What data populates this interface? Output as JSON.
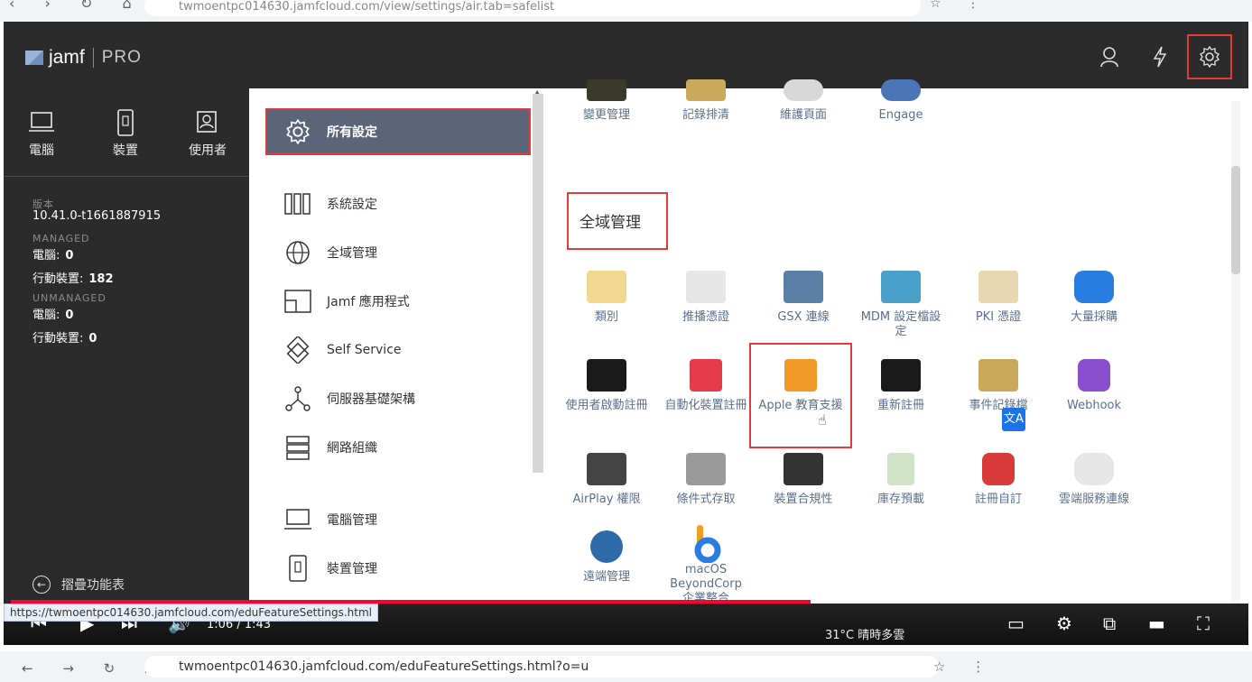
{
  "browser": {
    "top_url": "twmoentpc014630.jamfcloud.com/view/settings/air.tab=safelist",
    "bottom_url": "twmoentpc014630.jamfcloud.com/eduFeatureSettings.html?o=u"
  },
  "header": {
    "logo_text": "jamf",
    "logo_pro": "PRO",
    "icons": [
      "user-icon",
      "lightning-icon",
      "gear-icon"
    ]
  },
  "nav": {
    "items": [
      {
        "label": "電腦",
        "icon": "computer-icon"
      },
      {
        "label": "裝置",
        "icon": "device-icon"
      },
      {
        "label": "使用者",
        "icon": "users-icon"
      }
    ]
  },
  "info": {
    "version_label": "版本",
    "version": "10.41.0-t1661887915",
    "managed_label": "MANAGED",
    "managed_computers_label": "電腦:",
    "managed_computers": "0",
    "managed_devices_label": "行動裝置:",
    "managed_devices": "182",
    "unmanaged_label": "UNMANAGED",
    "unmanaged_computers_label": "電腦:",
    "unmanaged_computers": "0",
    "unmanaged_devices_label": "行動裝置:",
    "unmanaged_devices": "0"
  },
  "collapse_label": "摺疊功能表",
  "categories": [
    {
      "label": "所有設定",
      "icon": "gear-icon",
      "active": true
    },
    {
      "label": "系統設定",
      "icon": "columns-icon"
    },
    {
      "label": "全域管理",
      "icon": "globe-icon"
    },
    {
      "label": "Jamf 應用程式",
      "icon": "app-icon"
    },
    {
      "label": "Self Service",
      "icon": "self-service-icon"
    },
    {
      "label": "伺服器基礎架構",
      "icon": "network-node-icon"
    },
    {
      "label": "網路組織",
      "icon": "server-stack-icon"
    },
    {
      "label": "電腦管理",
      "icon": "computer-icon"
    },
    {
      "label": "裝置管理",
      "icon": "device-icon"
    }
  ],
  "section_title": "全域管理",
  "top_tiles": [
    {
      "label": "變更管理",
      "color": "#3a3a2a"
    },
    {
      "label": "記錄排清",
      "color": "#c9a95a"
    },
    {
      "label": "維護頁面",
      "color": "#d8d8d8"
    },
    {
      "label": "Engage",
      "color": "#4a76b8"
    }
  ],
  "tiles": [
    {
      "label": "類別",
      "color": "#f0d890",
      "icon": "folder-icon"
    },
    {
      "label": "推播憑證",
      "color": "#e6e6e6",
      "icon": "cloud-push-icon"
    },
    {
      "label": "GSX 連線",
      "color": "#5c7fa8",
      "icon": "gsx-icon"
    },
    {
      "label": "MDM 設定檔設定",
      "color": "#4aa0c8",
      "icon": "mdm-profile-icon"
    },
    {
      "label": "PKI 憑證",
      "color": "#e8d7b0",
      "icon": "certificate-icon"
    },
    {
      "label": "大量採購",
      "color": "#2a7de0",
      "icon": "app-store-icon"
    },
    {
      "label": "使用者啟動註冊",
      "color": "#1a1a1a",
      "icon": "user-enrollment-icon"
    },
    {
      "label": "自動化裝置註冊",
      "color": "#e63b4a",
      "icon": "device-enrollment-icon"
    },
    {
      "label": "Apple 教育支援",
      "color": "#f19a2a",
      "icon": "education-icon"
    },
    {
      "label": "重新註冊",
      "color": "#1a1a1a",
      "icon": "re-enrollment-icon"
    },
    {
      "label": "事件記錄檔",
      "color": "#c9a95a",
      "icon": "event-log-icon"
    },
    {
      "label": "Webhook",
      "color": "#8a4fcf",
      "icon": "webhook-icon"
    },
    {
      "label": "AirPlay 權限",
      "color": "#444",
      "icon": "airplay-icon"
    },
    {
      "label": "條件式存取",
      "color": "#9a9a9a",
      "icon": "conditional-access-icon"
    },
    {
      "label": "裝置合規性",
      "color": "#333",
      "icon": "compliance-icon"
    },
    {
      "label": "庫存預載",
      "color": "#cfe3c6",
      "icon": "inventory-icon"
    },
    {
      "label": "註冊自訂",
      "color": "#d93a3a",
      "icon": "enrollment-custom-icon"
    },
    {
      "label": "雲端服務連線",
      "color": "#e6e6e6",
      "icon": "cloud-service-icon"
    },
    {
      "label": "遠端管理",
      "color": "#2f6aa8",
      "icon": "remote-mgmt-icon"
    },
    {
      "label": "macOS BeyondCorp 企業整合",
      "color": "#ffffff",
      "icon": "beyondcorp-icon"
    }
  ],
  "video": {
    "time": "1:06 / 1:43",
    "status_url": "https://twmoentpc014630.jamfcloud.com/eduFeatureSettings.html",
    "weather": "31°C 晴時多雲",
    "progress": 0.65
  }
}
